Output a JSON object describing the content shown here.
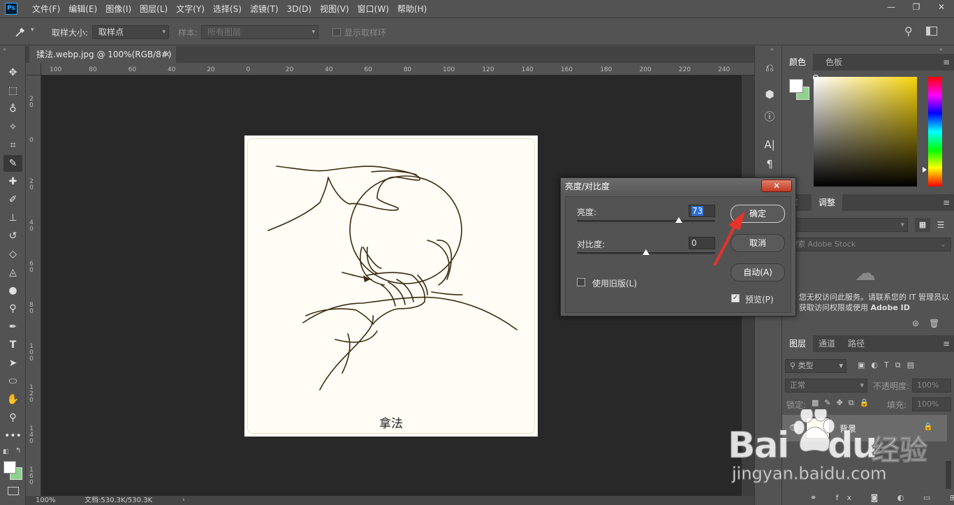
{
  "app": {
    "logo": "Ps"
  },
  "menu": [
    "文件(F)",
    "编辑(E)",
    "图像(I)",
    "图层(L)",
    "文字(Y)",
    "选择(S)",
    "滤镜(T)",
    "3D(D)",
    "视图(V)",
    "窗口(W)",
    "帮助(H)"
  ],
  "window_controls": {
    "minimize": "—",
    "restore": "❐",
    "close": "✕"
  },
  "options": {
    "sample_size_label": "取样大小:",
    "sample_size_value": "取样点",
    "sample_label": "样本:",
    "sample_value": "所有图层",
    "show_ring_label": "显示取样环"
  },
  "document": {
    "tab_title": "揉法.webp.jpg @ 100%(RGB/8#)",
    "tab_close": "✕",
    "caption": "拿法",
    "zoom": "100%",
    "doc_info": "文档:530.3K/530.3K"
  },
  "ruler_h": [
    "100",
    "80",
    "60",
    "40",
    "20",
    "0",
    "20",
    "40",
    "60",
    "80",
    "100",
    "120",
    "140",
    "160",
    "180",
    "200",
    "220",
    "240"
  ],
  "ruler_v": [
    "2\n0",
    "0",
    "2\n0",
    "4\n0",
    "6\n0",
    "8\n0",
    "1\n0\n0",
    "1\n2\n0",
    "1\n4\n0",
    "1\n6\n0"
  ],
  "panels": {
    "color_tabs": [
      "颜色",
      "色板"
    ],
    "library_tabs": [
      "库",
      "调整"
    ],
    "library_search_placeholder": "搜索 Adobe Stock",
    "library_message": "您无权访问此服务。请联系您的 IT 管理员以获取访问权限或使用",
    "library_message_bold": "Adobe ID",
    "layers_tabs": [
      "图层",
      "通道",
      "路径"
    ],
    "layers_filter": "类型",
    "blend_mode": "正常",
    "opacity_label": "不透明度:",
    "opacity_value": "100%",
    "lock_label": "锁定:",
    "fill_label": "填充:",
    "fill_value": "100%",
    "layer_name": "背景"
  },
  "dialog": {
    "title": "亮度/对比度",
    "close": "✕",
    "brightness_label": "亮度:",
    "brightness_value": "73",
    "contrast_label": "对比度:",
    "contrast_value": "0",
    "legacy_label": "使用旧版(L)",
    "ok_label": "确定",
    "cancel_label": "取消",
    "auto_label": "自动(A)",
    "preview_label": "预览(P)",
    "preview_checked": true,
    "legacy_checked": false
  },
  "watermark": {
    "brand": "Bai",
    "brand2": "du",
    "cn": "经验",
    "url": "jingyan.baidu.com"
  }
}
